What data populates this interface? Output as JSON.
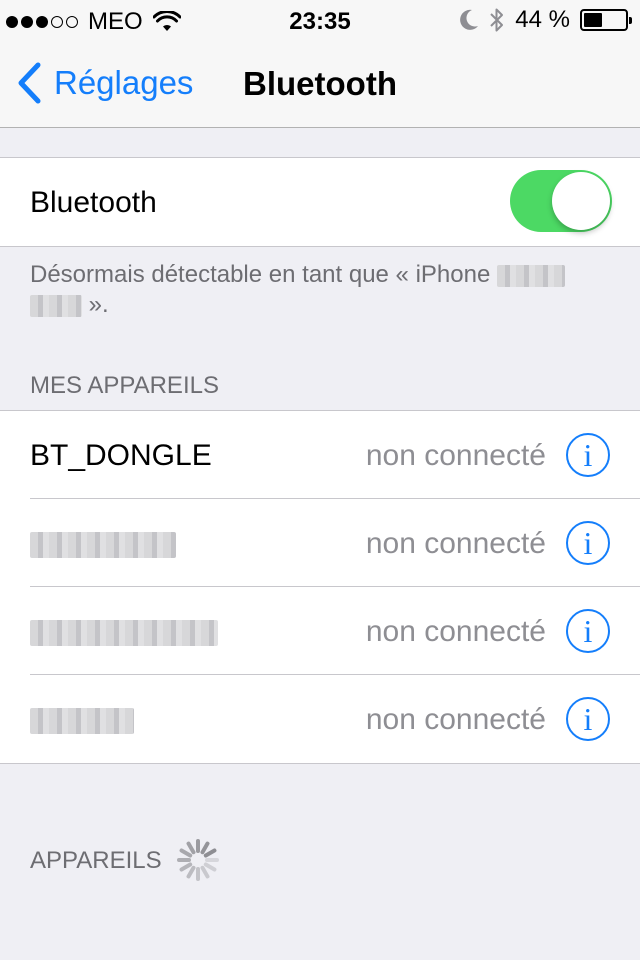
{
  "status_bar": {
    "carrier": "MEO",
    "time": "23:35",
    "battery_percent": "44 %",
    "battery_level": 0.44,
    "signal_bars_filled": 3,
    "signal_bars_total": 5,
    "icons": [
      "wifi-icon",
      "moon-icon",
      "bluetooth-icon",
      "battery-icon"
    ]
  },
  "nav": {
    "back_label": "Réglages",
    "title": "Bluetooth"
  },
  "bluetooth_toggle": {
    "label": "Bluetooth",
    "on": true,
    "color": "#4cd964"
  },
  "discoverable_note": {
    "text_before": "Désormais détectable en tant que « iPhone",
    "text_after": "»."
  },
  "my_devices": {
    "header": "MES APPAREILS",
    "items": [
      {
        "name": "BT_DONGLE",
        "status": "non connecté"
      },
      {
        "name": "",
        "status": "non connecté"
      },
      {
        "name": "",
        "status": "non connecté"
      },
      {
        "name": "",
        "status": "non connecté"
      }
    ],
    "info_glyph": "i"
  },
  "devices_section": {
    "header": "APPAREILS"
  },
  "colors": {
    "accent": "#147efb",
    "toggle_on": "#4cd964",
    "secondary_text": "#8e8e93",
    "background": "#efeff4"
  }
}
